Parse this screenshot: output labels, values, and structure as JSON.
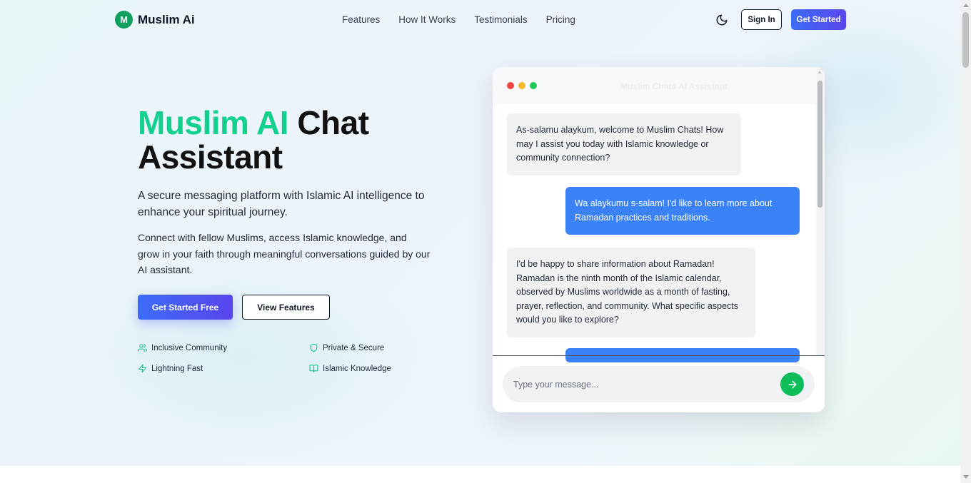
{
  "header": {
    "logo_letter": "M",
    "brand": "Muslim Ai",
    "nav": [
      "Features",
      "How It Works",
      "Testimonials",
      "Pricing"
    ],
    "theme_icon": "moon-icon",
    "signin_label": "Sign In",
    "cta_label": "Get Started"
  },
  "hero": {
    "title_accent": "Muslim AI",
    "title_rest": "Chat",
    "title_line2": "Assistant",
    "subtitle": "A secure messaging platform with Islamic AI intelligence to enhance your spiritual journey.",
    "body": "Connect with fellow Muslims, access Islamic knowledge, and grow in your faith through meaningful conversations guided by our AI assistant.",
    "primary_button": "Get Started Free",
    "secondary_button": "View Features",
    "features": [
      {
        "label": "Inclusive Community",
        "icon": "users-icon"
      },
      {
        "label": "Private & Secure",
        "icon": "shield-icon"
      },
      {
        "label": "Lightning Fast",
        "icon": "lightning-icon"
      },
      {
        "label": "Islamic Knowledge",
        "icon": "book-icon"
      }
    ]
  },
  "chat": {
    "title": "Muslim Chats AI Assistant",
    "messages": [
      {
        "from": "bot",
        "text": "As-salamu alaykum, welcome to Muslim Chats! How may I assist you today with Islamic knowledge or community connection?"
      },
      {
        "from": "user",
        "text": "Wa alaykumu s-salam! I'd like to learn more about Ramadan practices and traditions."
      },
      {
        "from": "bot",
        "text": "I'd be happy to share information about Ramadan! Ramadan is the ninth month of the Islamic calendar, observed by Muslims worldwide as a month of fasting, prayer, reflection, and community. What specific aspects would you like to explore?"
      },
      {
        "from": "user",
        "text": ""
      }
    ],
    "input_placeholder": "Type your message...",
    "send_icon": "arrow-right-icon"
  },
  "colors": {
    "accent_green": "#12d18e",
    "brand_blue": "#3b6cf6",
    "user_bubble": "#3b82f6",
    "send_button": "#0fbd5a"
  }
}
